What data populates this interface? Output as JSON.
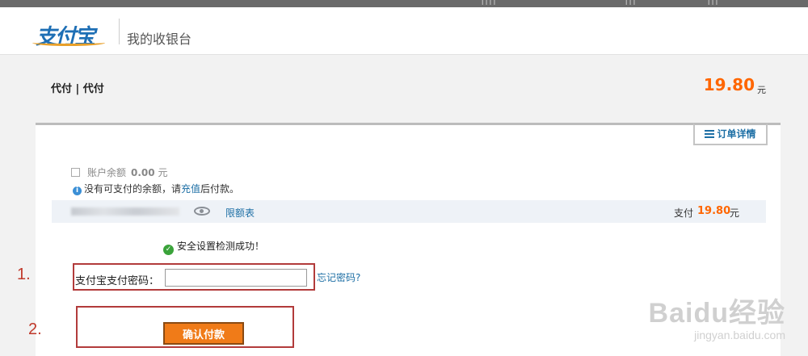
{
  "topbar": {
    "frag1": "I I I I",
    "frag2": "I I I",
    "frag3": "I I I"
  },
  "header": {
    "logo": "支付宝",
    "title": "我的收银台"
  },
  "order": {
    "name": "代付 | 代付",
    "amount": "19.80",
    "unit": "元"
  },
  "detail_tab": {
    "label": "订单详情"
  },
  "balance": {
    "label": "账户余额",
    "amount": "0.00",
    "unit": "元"
  },
  "balance_note": {
    "prefix": "没有可支付的余额，请",
    "link": "充值",
    "suffix": "后付款。"
  },
  "card_row": {
    "limit_link": "限额表",
    "pay_label": "支付",
    "pay_amount": "19.80",
    "pay_unit": "元"
  },
  "security": {
    "message": "安全设置检测成功！"
  },
  "password": {
    "label": "支付宝支付密码：",
    "value": "",
    "forgot_link": "忘记密码?"
  },
  "confirm": {
    "label": "确认付款"
  },
  "annotations": {
    "step1": "1.",
    "step2": "2.",
    "box_color": "#b23b3b"
  },
  "watermark": {
    "brand": "Baidu经验",
    "url": "jingyan.baidu.com"
  },
  "colors": {
    "accent_orange": "#f60",
    "link_blue": "#1d6fa5",
    "button_orange": "#f07b18",
    "success_green": "#3aa33a"
  }
}
